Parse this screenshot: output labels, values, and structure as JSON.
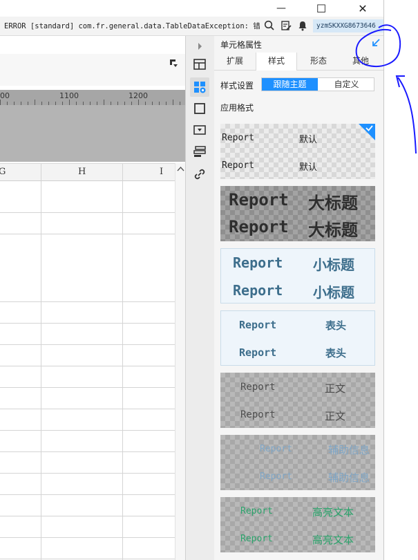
{
  "window": {
    "minimize_glyph": "—",
    "maximize_glyph": "☐",
    "close_glyph": "✕"
  },
  "errorbar": {
    "message": "ERROR [standard] com.fr.general.data.TableDataException: 错...",
    "user": "yzmSKXXG8673646"
  },
  "grid": {
    "ruler_labels": [
      "00",
      "1100",
      "1200"
    ],
    "column_headers": [
      "G",
      "H",
      "I"
    ]
  },
  "panel": {
    "title": "单元格属性",
    "tabs": [
      "扩展",
      "样式",
      "形态",
      "其他"
    ],
    "active_tab": "样式",
    "style_setting_label": "样式设置",
    "segment_follow": "跟随主题",
    "segment_custom": "自定义",
    "apply_format_label": "应用格式",
    "cards": [
      {
        "name": "default",
        "left": "Report",
        "right": "默认",
        "selected": true
      },
      {
        "name": "main-title",
        "left": "Report",
        "right": "大标题"
      },
      {
        "name": "subtitle",
        "left": "Report",
        "right": "小标题"
      },
      {
        "name": "header",
        "left": "Report",
        "right": "表头"
      },
      {
        "name": "body-text",
        "left": "Report",
        "right": "正文"
      },
      {
        "name": "auxiliary",
        "left": "Report",
        "right": "辅助信息"
      },
      {
        "name": "highlight",
        "left": "Report",
        "right": "高亮文本"
      }
    ]
  },
  "colors": {
    "accent": "#1e90ff",
    "annotation": "#1a1aff",
    "subtitle_text": "#3d6e8c",
    "auxiliary_text": "#7fa6c6",
    "highlight_text": "#2aa36b"
  },
  "annotation": {
    "arrow_icon": "collapse-arrow-icon"
  }
}
